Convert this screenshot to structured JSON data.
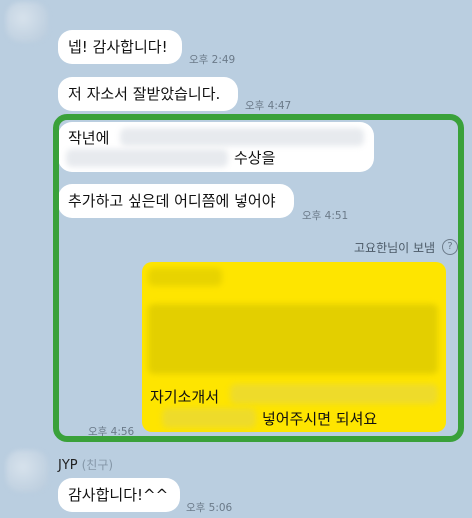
{
  "messages": {
    "m1": {
      "text": "넵! 감사합니다!",
      "time": "오후 2:49"
    },
    "m2": {
      "text": "저 자소서 잘받았습니다.",
      "time": "오후 4:47"
    },
    "m3": {
      "line1_prefix": "작년에",
      "line2_suffix": "수상을"
    },
    "m4": {
      "text": "추가하고 싶은데 어디쯤에 넣어야",
      "time": "오후 4:51"
    },
    "m5": {
      "sender": "고요한님이 보냄",
      "info_glyph": "?",
      "line1_prefix": "자기소개서",
      "line2_suffix": "넣어주시면 되셔요",
      "time": "오후 4:56"
    },
    "m6": {
      "name": "JYP",
      "relation": "(친구)",
      "text": "감사합니다!^^",
      "time": "오후 5:06"
    }
  },
  "colors": {
    "background": "#bacee0",
    "bubble_white": "#ffffff",
    "bubble_yellow": "#fee500",
    "highlight_frame": "#3aa13a"
  }
}
